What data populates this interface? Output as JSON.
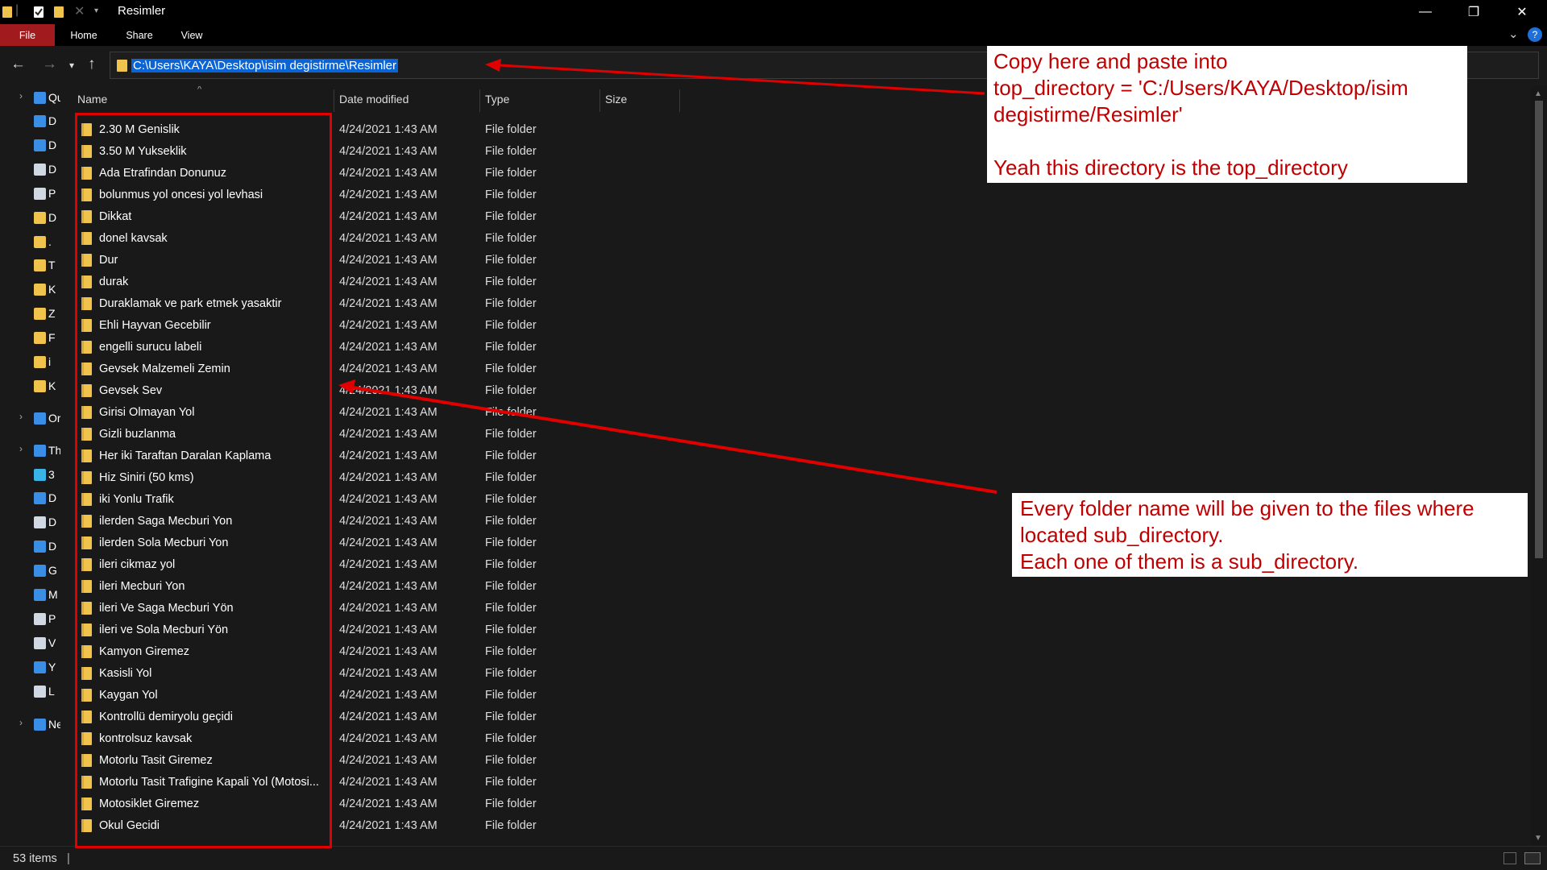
{
  "window": {
    "title": "Resimler",
    "controls": {
      "minimize": "—",
      "maximize": "❐",
      "close": "✕"
    }
  },
  "ribbon": {
    "tabs": [
      "File",
      "Home",
      "Share",
      "View"
    ],
    "file_tab_color": "#a01a1e"
  },
  "address_bar": {
    "path": "C:\\Users\\KAYA\\Desktop\\isim degistirme\\Resimler",
    "selection_color": "#0a64d6"
  },
  "nav_pane": {
    "items": [
      {
        "label": "Qu",
        "icon": "star-icon",
        "color": "#3a8ee6"
      },
      {
        "label": "D",
        "icon": "desktop-icon",
        "color": "#3a8ee6"
      },
      {
        "label": "D",
        "icon": "download-icon",
        "color": "#3a8ee6"
      },
      {
        "label": "D",
        "icon": "document-icon",
        "color": "#cfd8e3"
      },
      {
        "label": "P",
        "icon": "pictures-icon",
        "color": "#cfd8e3"
      },
      {
        "label": "D",
        "icon": "folder-icon",
        "color": "#f0c44c"
      },
      {
        "label": ".",
        "icon": "folder-icon",
        "color": "#f0c44c"
      },
      {
        "label": "T",
        "icon": "folder-icon",
        "color": "#f0c44c"
      },
      {
        "label": "K",
        "icon": "folder-icon",
        "color": "#f0c44c"
      },
      {
        "label": "Z",
        "icon": "folder-icon",
        "color": "#f0c44c"
      },
      {
        "label": "F",
        "icon": "folder-icon",
        "color": "#f0c44c"
      },
      {
        "label": "i",
        "icon": "folder-icon",
        "color": "#f0c44c"
      },
      {
        "label": "K",
        "icon": "folder-icon",
        "color": "#f0c44c"
      },
      {
        "label": "Or",
        "icon": "onedrive-icon",
        "color": "#3a8ee6"
      },
      {
        "label": "Th",
        "icon": "this-pc-icon",
        "color": "#3a8ee6"
      },
      {
        "label": "3",
        "icon": "3d-objects-icon",
        "color": "#3ab4e6"
      },
      {
        "label": "D",
        "icon": "desktop-icon",
        "color": "#3a8ee6"
      },
      {
        "label": "D",
        "icon": "document-icon",
        "color": "#cfd8e3"
      },
      {
        "label": "D",
        "icon": "download-icon",
        "color": "#3a8ee6"
      },
      {
        "label": "G",
        "icon": "gallery-icon",
        "color": "#3a8ee6"
      },
      {
        "label": "M",
        "icon": "music-icon",
        "color": "#3a8ee6"
      },
      {
        "label": "P",
        "icon": "pictures-icon",
        "color": "#cfd8e3"
      },
      {
        "label": "V",
        "icon": "videos-icon",
        "color": "#cfd8e3"
      },
      {
        "label": "Y",
        "icon": "drive-icon",
        "color": "#3a8ee6"
      },
      {
        "label": "L",
        "icon": "drive-icon",
        "color": "#cfd8e3"
      },
      {
        "label": "Ne",
        "icon": "network-icon",
        "color": "#3a8ee6"
      }
    ]
  },
  "columns": {
    "name": "Name",
    "date": "Date modified",
    "type": "Type",
    "size": "Size"
  },
  "files": [
    {
      "name": "2.30 M Genislik",
      "date": "4/24/2021 1:43 AM",
      "type": "File folder"
    },
    {
      "name": "3.50 M Yukseklik",
      "date": "4/24/2021 1:43 AM",
      "type": "File folder"
    },
    {
      "name": "Ada Etrafindan Donunuz",
      "date": "4/24/2021 1:43 AM",
      "type": "File folder"
    },
    {
      "name": "bolunmus yol oncesi yol levhasi",
      "date": "4/24/2021 1:43 AM",
      "type": "File folder"
    },
    {
      "name": "Dikkat",
      "date": "4/24/2021 1:43 AM",
      "type": "File folder"
    },
    {
      "name": "donel kavsak",
      "date": "4/24/2021 1:43 AM",
      "type": "File folder"
    },
    {
      "name": "Dur",
      "date": "4/24/2021 1:43 AM",
      "type": "File folder"
    },
    {
      "name": "durak",
      "date": "4/24/2021 1:43 AM",
      "type": "File folder"
    },
    {
      "name": "Duraklamak ve park etmek yasaktir",
      "date": "4/24/2021 1:43 AM",
      "type": "File folder"
    },
    {
      "name": "Ehli Hayvan Gecebilir",
      "date": "4/24/2021 1:43 AM",
      "type": "File folder"
    },
    {
      "name": "engelli surucu labeli",
      "date": "4/24/2021 1:43 AM",
      "type": "File folder"
    },
    {
      "name": "Gevsek Malzemeli Zemin",
      "date": "4/24/2021 1:43 AM",
      "type": "File folder"
    },
    {
      "name": "Gevsek Sev",
      "date": "4/24/2021 1:43 AM",
      "type": "File folder"
    },
    {
      "name": "Girisi Olmayan Yol",
      "date": "4/24/2021 1:43 AM",
      "type": "File folder"
    },
    {
      "name": "Gizli buzlanma",
      "date": "4/24/2021 1:43 AM",
      "type": "File folder"
    },
    {
      "name": "Her iki Taraftan Daralan Kaplama",
      "date": "4/24/2021 1:43 AM",
      "type": "File folder"
    },
    {
      "name": "Hiz Siniri (50 kms)",
      "date": "4/24/2021 1:43 AM",
      "type": "File folder"
    },
    {
      "name": "iki Yonlu Trafik",
      "date": "4/24/2021 1:43 AM",
      "type": "File folder"
    },
    {
      "name": "ilerden Saga Mecburi Yon",
      "date": "4/24/2021 1:43 AM",
      "type": "File folder"
    },
    {
      "name": "ilerden Sola Mecburi Yon",
      "date": "4/24/2021 1:43 AM",
      "type": "File folder"
    },
    {
      "name": "ileri cikmaz yol",
      "date": "4/24/2021 1:43 AM",
      "type": "File folder"
    },
    {
      "name": "ileri Mecburi Yon",
      "date": "4/24/2021 1:43 AM",
      "type": "File folder"
    },
    {
      "name": "ileri Ve Saga Mecburi Yön",
      "date": "4/24/2021 1:43 AM",
      "type": "File folder"
    },
    {
      "name": "ileri ve Sola Mecburi Yön",
      "date": "4/24/2021 1:43 AM",
      "type": "File folder"
    },
    {
      "name": "Kamyon Giremez",
      "date": "4/24/2021 1:43 AM",
      "type": "File folder"
    },
    {
      "name": "Kasisli Yol",
      "date": "4/24/2021 1:43 AM",
      "type": "File folder"
    },
    {
      "name": "Kaygan Yol",
      "date": "4/24/2021 1:43 AM",
      "type": "File folder"
    },
    {
      "name": "Kontrollü demiryolu geçidi",
      "date": "4/24/2021 1:43 AM",
      "type": "File folder"
    },
    {
      "name": "kontrolsuz kavsak",
      "date": "4/24/2021 1:43 AM",
      "type": "File folder"
    },
    {
      "name": "Motorlu Tasit Giremez",
      "date": "4/24/2021 1:43 AM",
      "type": "File folder"
    },
    {
      "name": "Motorlu Tasit Trafigine Kapali Yol (Motosi...",
      "date": "4/24/2021 1:43 AM",
      "type": "File folder"
    },
    {
      "name": "Motosiklet Giremez",
      "date": "4/24/2021 1:43 AM",
      "type": "File folder"
    },
    {
      "name": "Okul Gecidi",
      "date": "4/24/2021 1:43 AM",
      "type": "File folder"
    }
  ],
  "status": {
    "item_count": "53 items",
    "separator": "|"
  },
  "annotations": {
    "top_lines": [
      "Copy here and paste into",
      "top_directory = 'C:/Users/KAYA/Desktop/isim",
      "degistirme/Resimler'",
      "",
      "Yeah this directory is the top_directory"
    ],
    "bottom_lines": [
      "Every folder name will be given to the files where",
      "located sub_directory.",
      "Each one of them is a sub_directory."
    ],
    "color": "#c00000"
  }
}
